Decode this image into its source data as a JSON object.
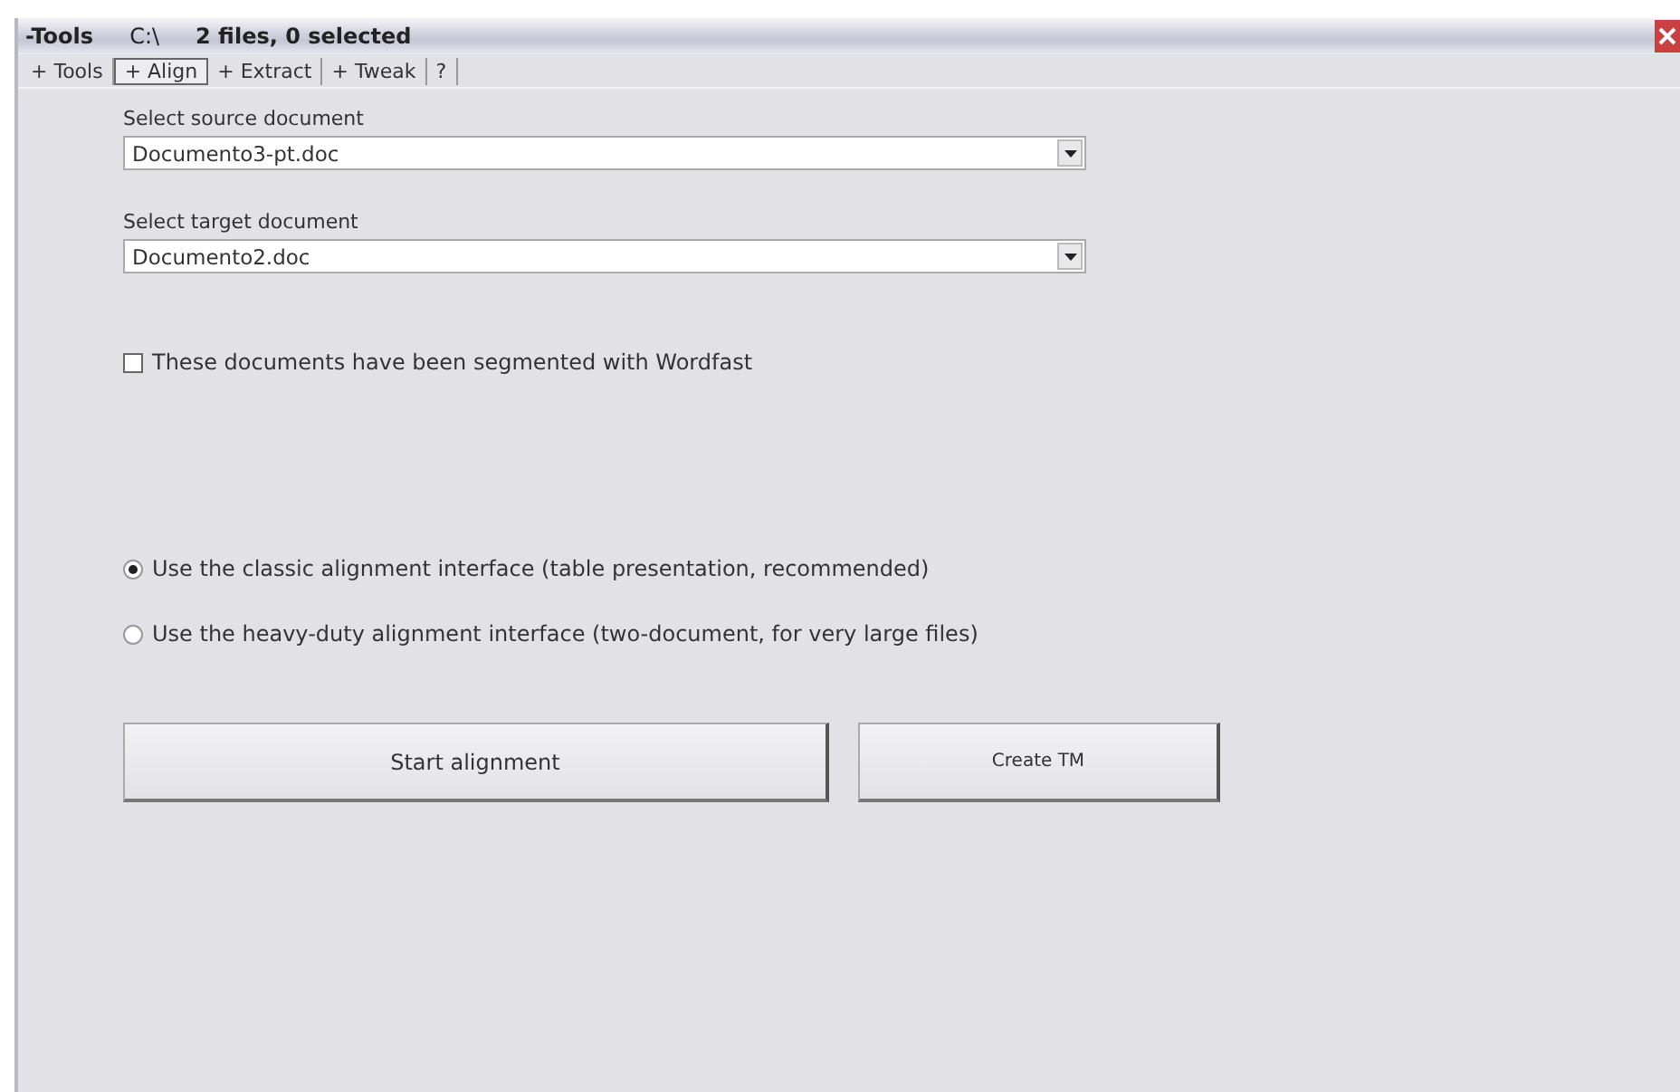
{
  "window": {
    "title": "-Tools",
    "path": "C:\\",
    "status": "2 files, 0 selected"
  },
  "tabs": [
    {
      "label": "+ Tools",
      "selected": false
    },
    {
      "label": "+ Align",
      "selected": true
    },
    {
      "label": "+ Extract",
      "selected": false
    },
    {
      "label": "+ Tweak",
      "selected": false
    },
    {
      "label": "?",
      "selected": false
    }
  ],
  "source": {
    "label": "Select source document",
    "value": "Documento3-pt.doc"
  },
  "target": {
    "label": "Select target document",
    "value": "Documento2.doc"
  },
  "segmented": {
    "label": "These documents have been segmented with Wordfast",
    "checked": false
  },
  "modes": [
    {
      "label": "Use the classic alignment interface (table presentation, recommended)",
      "selected": true
    },
    {
      "label": "Use the heavy-duty alignment interface (two-document, for very large files)",
      "selected": false
    }
  ],
  "buttons": [
    "Start alignment",
    "Create TM"
  ]
}
